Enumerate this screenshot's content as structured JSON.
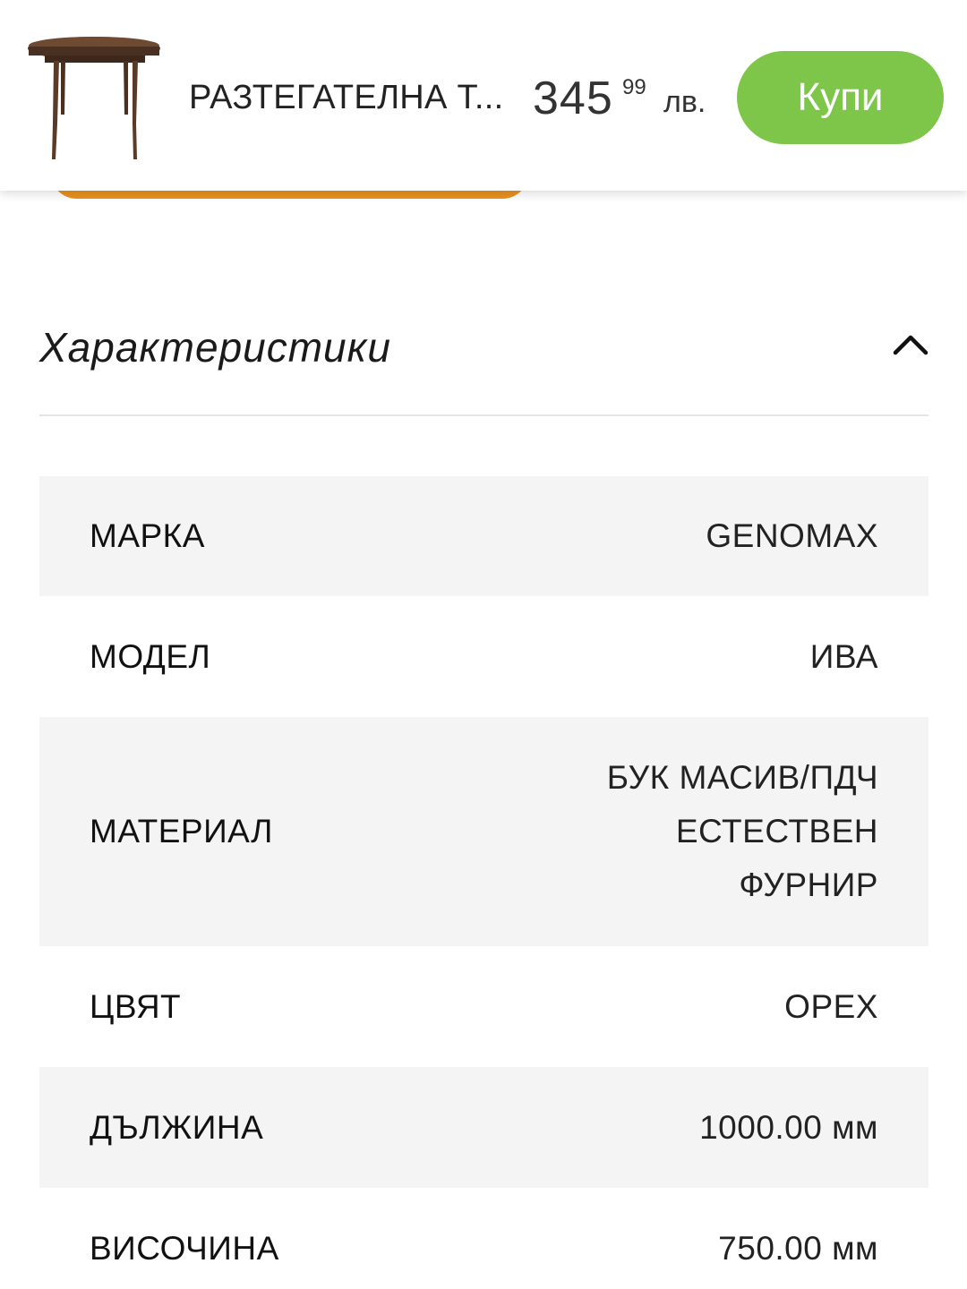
{
  "sticky_bar": {
    "product_name": "РАЗТЕГАТЕЛНА Т...",
    "price_main": "345",
    "price_cents": "99",
    "currency": "лв.",
    "buy_label": "Купи",
    "colors": {
      "buy_button": "#7ec64a",
      "orange_accent": "#e8921e"
    },
    "thumbnail_icon": "round-table-image"
  },
  "specs": {
    "title": "Характеристики",
    "toggle_icon": "chevron-up-icon",
    "rows": [
      {
        "label": "МАРКА",
        "value": "GENOMAX"
      },
      {
        "label": "МОДЕЛ",
        "value": "ИВА"
      },
      {
        "label": "МАТЕРИАЛ",
        "value": "БУК МАСИВ/ПДЧ ЕСТЕСТВЕН ФУРНИР"
      },
      {
        "label": "ЦВЯТ",
        "value": "ОРЕХ"
      },
      {
        "label": "ДЪЛЖИНА",
        "value": "1000.00 мм"
      },
      {
        "label": "ВИСОЧИНА",
        "value": "750.00 мм"
      }
    ]
  }
}
